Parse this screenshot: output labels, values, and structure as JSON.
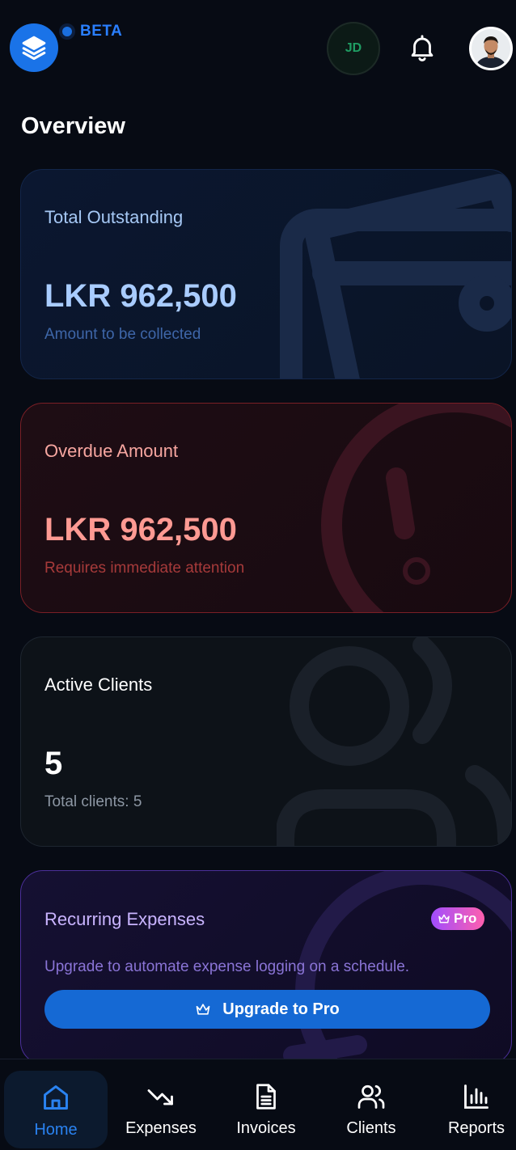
{
  "header": {
    "beta_label": "BETA",
    "initials": "JD",
    "page_title": "Overview"
  },
  "cards": {
    "outstanding": {
      "title": "Total Outstanding",
      "value": "LKR 962,500",
      "subtitle": "Amount to be collected"
    },
    "overdue": {
      "title": "Overdue Amount",
      "value": "LKR 962,500",
      "subtitle": "Requires immediate attention"
    },
    "clients": {
      "title": "Active Clients",
      "value": "5",
      "subtitle": "Total clients: 5"
    },
    "recurring": {
      "title": "Recurring Expenses",
      "badge": "Pro",
      "description": "Upgrade to automate expense logging on a schedule.",
      "button_label": "Upgrade to Pro"
    }
  },
  "nav": {
    "items": [
      {
        "label": "Home",
        "icon": "home-icon",
        "active": true
      },
      {
        "label": "Expenses",
        "icon": "trending-down-icon",
        "active": false
      },
      {
        "label": "Invoices",
        "icon": "document-icon",
        "active": false
      },
      {
        "label": "Clients",
        "icon": "users-icon",
        "active": false
      },
      {
        "label": "Reports",
        "icon": "bar-chart-icon",
        "active": false
      }
    ]
  },
  "colors": {
    "background": "#070b14",
    "accent": "#1a73e8",
    "overdue": "#ff9a93",
    "pro": "#a04dff"
  }
}
